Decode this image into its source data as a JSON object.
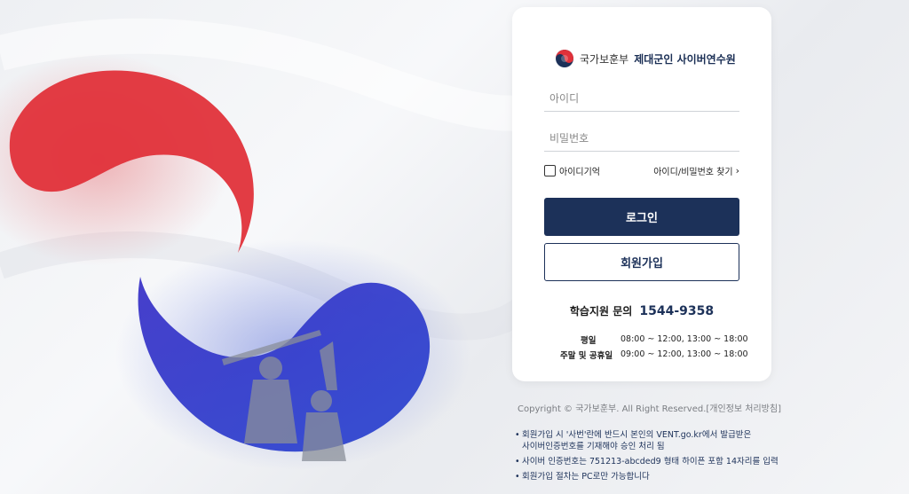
{
  "brand": {
    "ministry": "국가보훈부",
    "site": "제대군인 사이버연수원"
  },
  "login": {
    "id_placeholder": "아이디",
    "pw_placeholder": "비밀번호",
    "remember_label": "아이디기억",
    "find_link": "아이디/비밀번호 찾기",
    "login_button": "로그인",
    "join_button": "회원가입"
  },
  "support": {
    "label": "학습지원 문의",
    "phone": "1544-9358",
    "hours": [
      {
        "day": "평일",
        "time": "08:00 ~ 12:00, 13:00 ~ 18:00"
      },
      {
        "day": "주말 및 공휴일",
        "time": "09:00 ~ 12:00, 13:00 ~ 18:00"
      }
    ]
  },
  "footer": {
    "copyright": "Copyright © 국가보훈부. All Right Reserved.[개인정보 처리방침]",
    "notices": [
      "회원가입 시 '사번'란에 반드시 본인의 VENT.go.kr에서 발급받은\n사이버인증번호를 기재해야 승인 처리 됨",
      "사이버 인증번호는 751213-abcded9 형태 하이픈 포함 14자리를 입력",
      "회원가입 절차는 PC로만 가능합니다"
    ]
  },
  "colors": {
    "navy": "#1c3159",
    "taeguk_red": "#e0313a",
    "taeguk_blue": "#3340c4"
  },
  "icons": {
    "emblem": "taegeuk-emblem-icon",
    "chevron": "chevron-right-icon"
  }
}
